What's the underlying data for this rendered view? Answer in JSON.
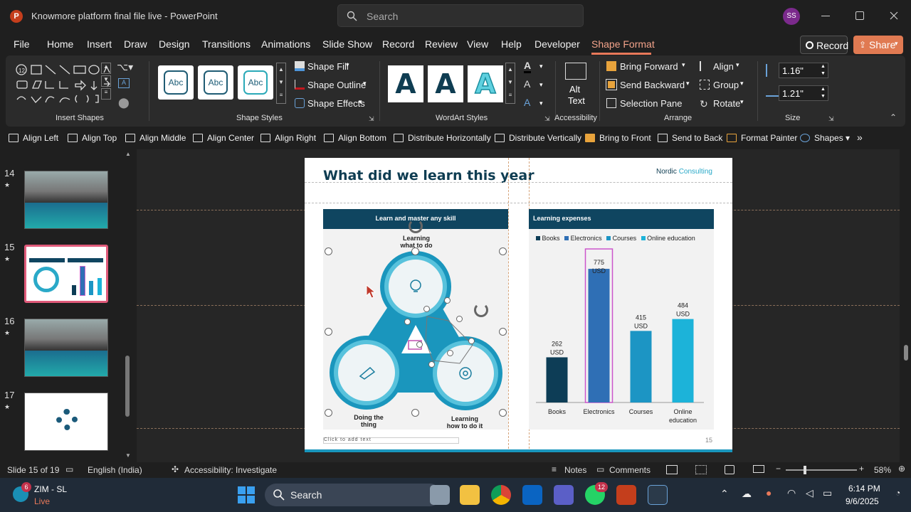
{
  "titlebar": {
    "file_title": "Knowmore platform final file live",
    "separator": "-",
    "app_name": "PowerPoint",
    "search_placeholder": "Search",
    "user_initials": "SS"
  },
  "menu": {
    "items": [
      "File",
      "Home",
      "Insert",
      "Draw",
      "Design",
      "Transitions",
      "Animations",
      "Slide Show",
      "Record",
      "Review",
      "View",
      "Help",
      "Developer",
      "Shape Format"
    ],
    "active": "Shape Format",
    "record_label": "Record",
    "share_label": "Share"
  },
  "ribbon": {
    "groups": {
      "insert_shapes": "Insert Shapes",
      "shape_styles": "Shape Styles",
      "wordart_styles": "WordArt Styles",
      "accessibility": "Accessibility",
      "arrange": "Arrange",
      "size": "Size"
    },
    "shape_style_samples": [
      "Abc",
      "Abc",
      "Abc"
    ],
    "shape_fill": "Shape Fill",
    "shape_outline": "Shape Outline",
    "shape_effects": "Shape Effects",
    "wordart_letter": "A",
    "alt_text_line1": "Alt",
    "alt_text_line2": "Text",
    "bring_forward": "Bring Forward",
    "send_backward": "Send Backward",
    "selection_pane": "Selection Pane",
    "align": "Align",
    "group": "Group",
    "rotate": "Rotate",
    "height": "1.16\"",
    "width": "1.21\""
  },
  "quickbar": [
    "Align Left",
    "Align Top",
    "Align Middle",
    "Align Center",
    "Align Right",
    "Align Bottom",
    "Distribute Horizontally",
    "Distribute Vertically",
    "Bring to Front",
    "Send to Back",
    "Format Painter",
    "Shapes"
  ],
  "thumbnails": [
    {
      "num": "14",
      "star": "★"
    },
    {
      "num": "15",
      "star": "★"
    },
    {
      "num": "16",
      "star": "★"
    },
    {
      "num": "17",
      "star": "★"
    }
  ],
  "slide": {
    "title": "What did we learn this year",
    "brand_dark": "Nordic",
    "brand_light": "Consulting",
    "left_header": "Learn and master any skill",
    "right_header": "Learning expenses",
    "labels": {
      "top": "Learning\nwhat to do",
      "left": "Doing the\nthing",
      "right": "Learning\nhow to do it"
    },
    "footer_placeholder": "Click to add text",
    "page_number": "15",
    "legend": [
      "Books",
      "Electronics",
      "Courses",
      "Online education"
    ]
  },
  "chart_data": {
    "type": "bar",
    "categories": [
      "Books",
      "Electronics",
      "Courses",
      "Online education"
    ],
    "values": [
      262,
      775,
      415,
      484
    ],
    "data_labels": [
      "262\nUSD",
      "775\nUSD",
      "415\nUSD",
      "484\nUSD"
    ],
    "colors": [
      "#0d3d56",
      "#2f6fb5",
      "#1c95c4",
      "#1cb3d9"
    ],
    "title": "Learning expenses",
    "ylim": [
      0,
      800
    ],
    "grid": false,
    "legend_position": "top"
  },
  "status": {
    "slide_info": "Slide 15 of 19",
    "language": "English (India)",
    "accessibility": "Accessibility: Investigate",
    "notes": "Notes",
    "comments": "Comments",
    "zoom": "58%"
  },
  "taskbar": {
    "weather_temp": "ZIM - SL",
    "weather_sub": "Live",
    "badge_count": "6",
    "search": "Search",
    "whatsapp_badge": "12",
    "time": "6:14 PM",
    "date": "9/6/2025"
  }
}
